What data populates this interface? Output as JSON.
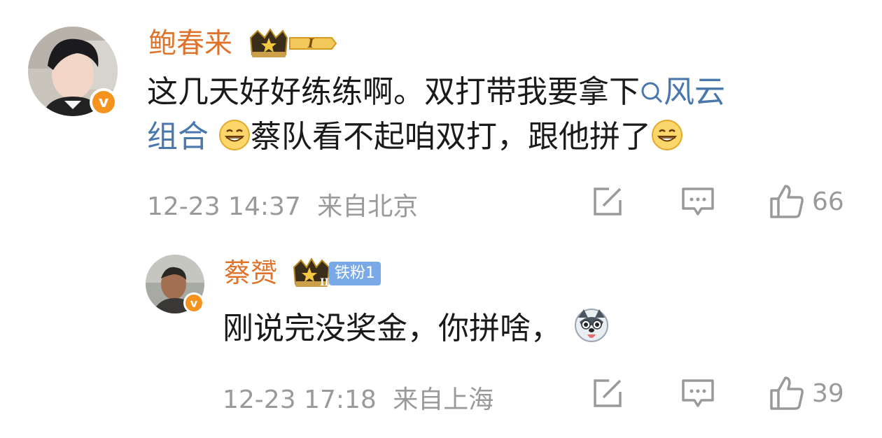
{
  "comments": [
    {
      "username": "鲍春来",
      "level_badge": "I",
      "text_part1": "这几天好好练练啊。双打带我要拿下",
      "link_text_1": "风云",
      "link_text_2": "组合",
      "text_part2": "蔡队看不起咱双打，跟他拼了",
      "timestamp": "12-23 14:37",
      "location": "来自北京",
      "like_count": "66",
      "verified": true
    },
    {
      "username": "蔡赟",
      "level_badge": "II",
      "fan_tag": "铁粉1",
      "text": "刚说完没奖金，你拼啥，",
      "timestamp": "12-23 17:18",
      "location": "来自上海",
      "like_count": "39",
      "verified": true
    }
  ],
  "icons": {
    "share": "share-icon",
    "comment": "comment-icon",
    "like": "like-icon",
    "search": "search-icon",
    "grin_emoji": "grin-emoji-icon",
    "husky_emoji": "husky-emoji-icon",
    "crown": "crown-icon"
  },
  "colors": {
    "username": "#e0732b",
    "link": "#4a78ad",
    "meta": "#9a9a9a",
    "verified": "#f6921e",
    "fan_tag": "#7aa9e8"
  }
}
